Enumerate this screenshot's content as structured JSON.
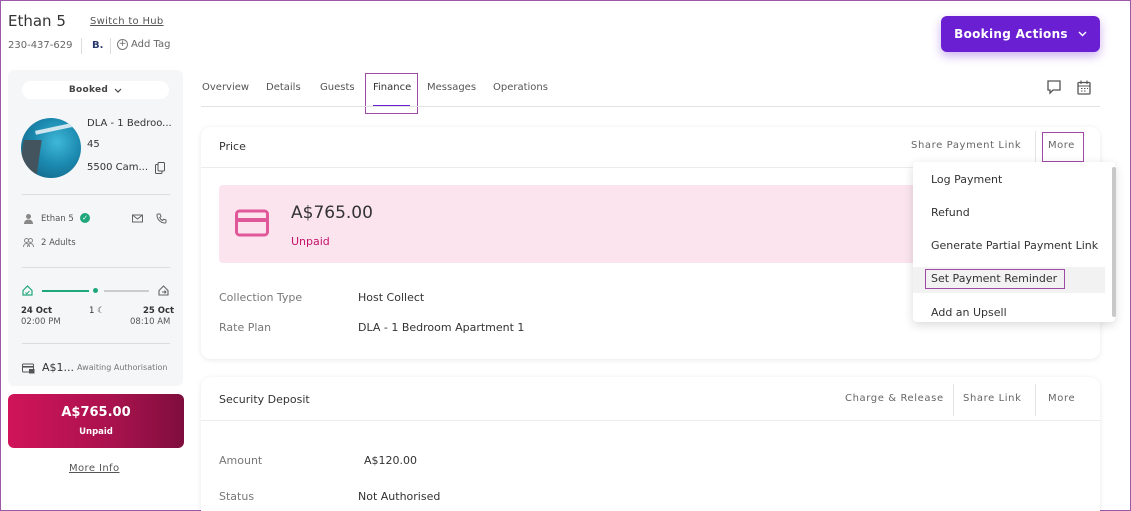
{
  "header": {
    "guest_name": "Ethan 5",
    "switch_hub": "Switch to Hub",
    "phone": "230-437-629",
    "badge": "B.",
    "add_tag": "Add Tag",
    "booking_actions": "Booking Actions"
  },
  "sidebar": {
    "status": "Booked",
    "property_name": "DLA - 1 Bedroo...",
    "property_number": "45",
    "property_address": "5500 Cam...",
    "guest": "Ethan 5",
    "occupants": "2 Adults",
    "checkin_date": "24 Oct",
    "checkin_time": "02:00 PM",
    "nights": "1",
    "checkout_date": "25 Oct",
    "checkout_time": "08:10 AM",
    "deposit_amount": "A$1...",
    "deposit_status": "Awaiting Authorisation",
    "total_amount": "A$765.00",
    "total_status": "Unpaid",
    "more_info": "More Info"
  },
  "tabs": [
    "Overview",
    "Details",
    "Guests",
    "Finance",
    "Messages",
    "Operations"
  ],
  "active_tab": "Finance",
  "price_section": {
    "title": "Price",
    "share_link": "Share Payment Link",
    "more": "More",
    "amount": "A$765.00",
    "status": "Unpaid",
    "rows": [
      {
        "label": "Collection Type",
        "value": "Host Collect"
      },
      {
        "label": "Rate Plan",
        "value": "DLA - 1 Bedroom Apartment 1"
      }
    ]
  },
  "more_menu": {
    "items": [
      "Log Payment",
      "Refund",
      "Generate Partial Payment Link",
      "Set Payment Reminder",
      "Add an Upsell"
    ],
    "highlighted": "Set Payment Reminder"
  },
  "security_deposit": {
    "title": "Security Deposit",
    "charge_release": "Charge & Release",
    "share_link": "Share Link",
    "more": "More",
    "rows": [
      {
        "label": "Amount",
        "value": "A$120.00"
      },
      {
        "label": "Status",
        "value": "Not Authorised"
      }
    ]
  },
  "colors": {
    "accent": "#6b1fd2",
    "pink_banner": "#fbe4ee",
    "unpaid": "#c4146a",
    "price_card": "#d1145a"
  }
}
